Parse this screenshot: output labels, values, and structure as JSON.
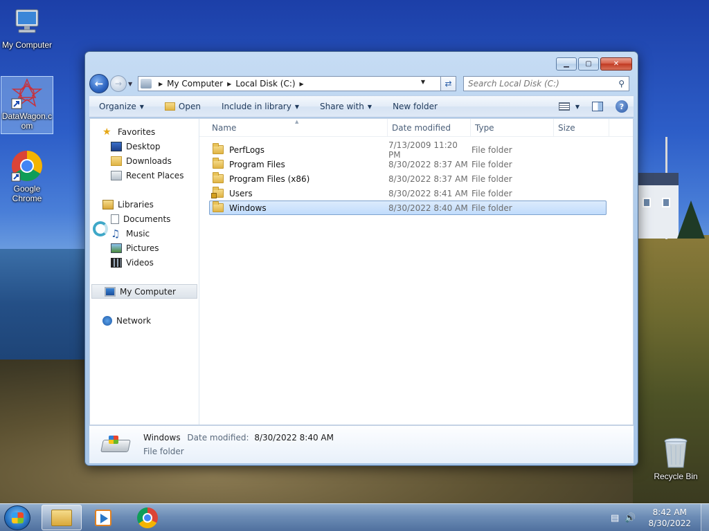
{
  "desktop": {
    "icons": [
      {
        "label": "My Computer",
        "icon": "computer-icon"
      },
      {
        "label": "DataWagon.com",
        "icon": "datawagon-shortcut-icon"
      },
      {
        "label": "Google Chrome",
        "icon": "chrome-icon"
      },
      {
        "label": "Recycle Bin",
        "icon": "recycle-bin-icon"
      }
    ]
  },
  "window": {
    "buttons": {
      "minimize": "▁",
      "maximize": "▢",
      "close": "✕"
    },
    "address": {
      "crumbs": [
        "My Computer",
        "Local Disk (C:)"
      ],
      "refresh_icon": "refresh-icon"
    },
    "search": {
      "placeholder": "Search Local Disk (C:)"
    },
    "toolbar": {
      "organize": "Organize",
      "open": "Open",
      "include_in_library": "Include in library",
      "share_with": "Share with",
      "new_folder": "New folder",
      "help": "?"
    },
    "nav": {
      "favorites": "Favorites",
      "desktop": "Desktop",
      "downloads": "Downloads",
      "recent_places": "Recent Places",
      "libraries": "Libraries",
      "documents": "Documents",
      "music": "Music",
      "pictures": "Pictures",
      "videos": "Videos",
      "my_computer": "My Computer",
      "network": "Network"
    },
    "columns": {
      "name": "Name",
      "date": "Date modified",
      "type": "Type",
      "size": "Size"
    },
    "files": [
      {
        "name": "PerfLogs",
        "date": "7/13/2009 11:20 PM",
        "type": "File folder"
      },
      {
        "name": "Program Files",
        "date": "8/30/2022 8:37 AM",
        "type": "File folder"
      },
      {
        "name": "Program Files (x86)",
        "date": "8/30/2022 8:37 AM",
        "type": "File folder"
      },
      {
        "name": "Users",
        "date": "8/30/2022 8:41 AM",
        "type": "File folder"
      },
      {
        "name": "Windows",
        "date": "8/30/2022 8:40 AM",
        "type": "File folder"
      }
    ],
    "selected_file": "Windows",
    "details": {
      "name": "Windows",
      "date_label": "Date modified:",
      "date_value": "8/30/2022 8:40 AM",
      "type": "File folder"
    }
  },
  "taskbar": {
    "clock_time": "8:42 AM",
    "clock_date": "8/30/2022",
    "items": [
      "explorer-icon",
      "media-player-icon",
      "chrome-icon"
    ]
  }
}
